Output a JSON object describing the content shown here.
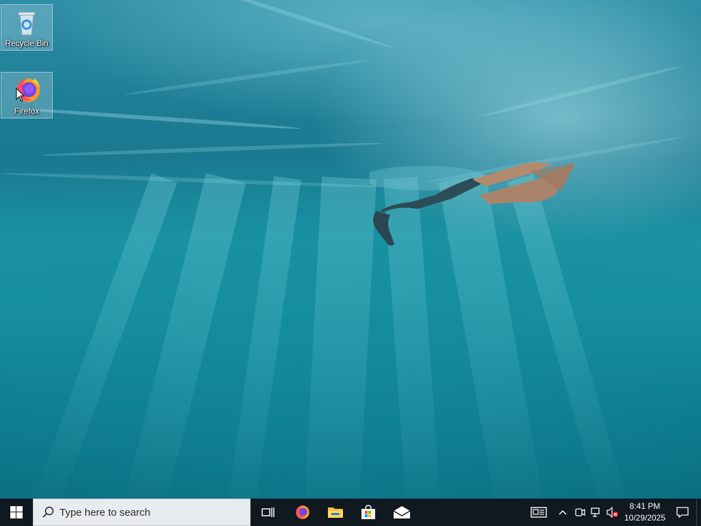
{
  "desktop": {
    "icons": [
      {
        "label": "Recycle Bin",
        "icon": "recycle-bin-icon"
      },
      {
        "label": "Firefox",
        "icon": "firefox-icon"
      }
    ]
  },
  "taskbar": {
    "search_placeholder": "Type here to search",
    "apps": [
      {
        "name": "task-view",
        "icon": "task-view-icon"
      },
      {
        "name": "firefox",
        "icon": "firefox-icon"
      },
      {
        "name": "file-explorer",
        "icon": "folder-icon"
      },
      {
        "name": "microsoft-store",
        "icon": "store-bag-icon"
      },
      {
        "name": "mail",
        "icon": "mail-icon"
      }
    ],
    "tray": {
      "icons": [
        "news-widget-icon",
        "chevron-up-icon",
        "meet-now-icon",
        "network-icon",
        "volume-muted-icon"
      ],
      "time": "8:41 PM",
      "date": "10/29/2025"
    }
  },
  "colors": {
    "taskbar_bg": "#101820",
    "search_bg": "#e9ecee",
    "water_top": "#2f8ea6",
    "water_bottom": "#0b6f82"
  }
}
